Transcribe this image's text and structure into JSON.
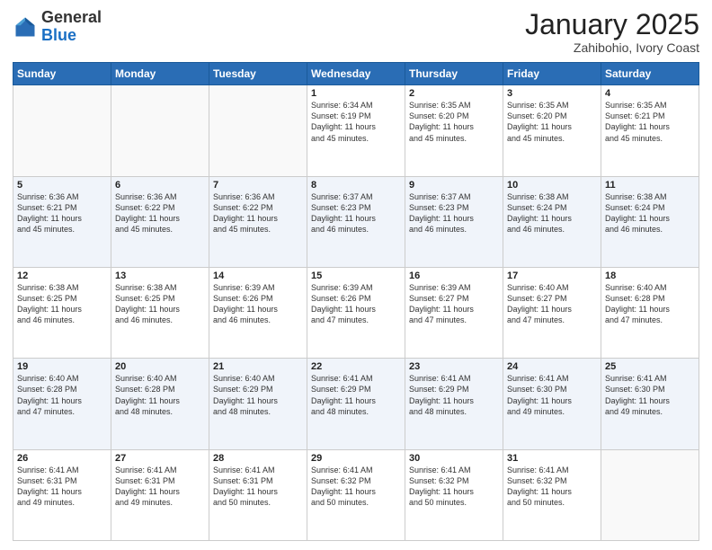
{
  "header": {
    "logo_general": "General",
    "logo_blue": "Blue",
    "month": "January 2025",
    "location": "Zahibohio, Ivory Coast"
  },
  "weekdays": [
    "Sunday",
    "Monday",
    "Tuesday",
    "Wednesday",
    "Thursday",
    "Friday",
    "Saturday"
  ],
  "weeks": [
    [
      {
        "day": "",
        "info": ""
      },
      {
        "day": "",
        "info": ""
      },
      {
        "day": "",
        "info": ""
      },
      {
        "day": "1",
        "info": "Sunrise: 6:34 AM\nSunset: 6:19 PM\nDaylight: 11 hours\nand 45 minutes."
      },
      {
        "day": "2",
        "info": "Sunrise: 6:35 AM\nSunset: 6:20 PM\nDaylight: 11 hours\nand 45 minutes."
      },
      {
        "day": "3",
        "info": "Sunrise: 6:35 AM\nSunset: 6:20 PM\nDaylight: 11 hours\nand 45 minutes."
      },
      {
        "day": "4",
        "info": "Sunrise: 6:35 AM\nSunset: 6:21 PM\nDaylight: 11 hours\nand 45 minutes."
      }
    ],
    [
      {
        "day": "5",
        "info": "Sunrise: 6:36 AM\nSunset: 6:21 PM\nDaylight: 11 hours\nand 45 minutes."
      },
      {
        "day": "6",
        "info": "Sunrise: 6:36 AM\nSunset: 6:22 PM\nDaylight: 11 hours\nand 45 minutes."
      },
      {
        "day": "7",
        "info": "Sunrise: 6:36 AM\nSunset: 6:22 PM\nDaylight: 11 hours\nand 45 minutes."
      },
      {
        "day": "8",
        "info": "Sunrise: 6:37 AM\nSunset: 6:23 PM\nDaylight: 11 hours\nand 46 minutes."
      },
      {
        "day": "9",
        "info": "Sunrise: 6:37 AM\nSunset: 6:23 PM\nDaylight: 11 hours\nand 46 minutes."
      },
      {
        "day": "10",
        "info": "Sunrise: 6:38 AM\nSunset: 6:24 PM\nDaylight: 11 hours\nand 46 minutes."
      },
      {
        "day": "11",
        "info": "Sunrise: 6:38 AM\nSunset: 6:24 PM\nDaylight: 11 hours\nand 46 minutes."
      }
    ],
    [
      {
        "day": "12",
        "info": "Sunrise: 6:38 AM\nSunset: 6:25 PM\nDaylight: 11 hours\nand 46 minutes."
      },
      {
        "day": "13",
        "info": "Sunrise: 6:38 AM\nSunset: 6:25 PM\nDaylight: 11 hours\nand 46 minutes."
      },
      {
        "day": "14",
        "info": "Sunrise: 6:39 AM\nSunset: 6:26 PM\nDaylight: 11 hours\nand 46 minutes."
      },
      {
        "day": "15",
        "info": "Sunrise: 6:39 AM\nSunset: 6:26 PM\nDaylight: 11 hours\nand 47 minutes."
      },
      {
        "day": "16",
        "info": "Sunrise: 6:39 AM\nSunset: 6:27 PM\nDaylight: 11 hours\nand 47 minutes."
      },
      {
        "day": "17",
        "info": "Sunrise: 6:40 AM\nSunset: 6:27 PM\nDaylight: 11 hours\nand 47 minutes."
      },
      {
        "day": "18",
        "info": "Sunrise: 6:40 AM\nSunset: 6:28 PM\nDaylight: 11 hours\nand 47 minutes."
      }
    ],
    [
      {
        "day": "19",
        "info": "Sunrise: 6:40 AM\nSunset: 6:28 PM\nDaylight: 11 hours\nand 47 minutes."
      },
      {
        "day": "20",
        "info": "Sunrise: 6:40 AM\nSunset: 6:28 PM\nDaylight: 11 hours\nand 48 minutes."
      },
      {
        "day": "21",
        "info": "Sunrise: 6:40 AM\nSunset: 6:29 PM\nDaylight: 11 hours\nand 48 minutes."
      },
      {
        "day": "22",
        "info": "Sunrise: 6:41 AM\nSunset: 6:29 PM\nDaylight: 11 hours\nand 48 minutes."
      },
      {
        "day": "23",
        "info": "Sunrise: 6:41 AM\nSunset: 6:29 PM\nDaylight: 11 hours\nand 48 minutes."
      },
      {
        "day": "24",
        "info": "Sunrise: 6:41 AM\nSunset: 6:30 PM\nDaylight: 11 hours\nand 49 minutes."
      },
      {
        "day": "25",
        "info": "Sunrise: 6:41 AM\nSunset: 6:30 PM\nDaylight: 11 hours\nand 49 minutes."
      }
    ],
    [
      {
        "day": "26",
        "info": "Sunrise: 6:41 AM\nSunset: 6:31 PM\nDaylight: 11 hours\nand 49 minutes."
      },
      {
        "day": "27",
        "info": "Sunrise: 6:41 AM\nSunset: 6:31 PM\nDaylight: 11 hours\nand 49 minutes."
      },
      {
        "day": "28",
        "info": "Sunrise: 6:41 AM\nSunset: 6:31 PM\nDaylight: 11 hours\nand 50 minutes."
      },
      {
        "day": "29",
        "info": "Sunrise: 6:41 AM\nSunset: 6:32 PM\nDaylight: 11 hours\nand 50 minutes."
      },
      {
        "day": "30",
        "info": "Sunrise: 6:41 AM\nSunset: 6:32 PM\nDaylight: 11 hours\nand 50 minutes."
      },
      {
        "day": "31",
        "info": "Sunrise: 6:41 AM\nSunset: 6:32 PM\nDaylight: 11 hours\nand 50 minutes."
      },
      {
        "day": "",
        "info": ""
      }
    ]
  ]
}
